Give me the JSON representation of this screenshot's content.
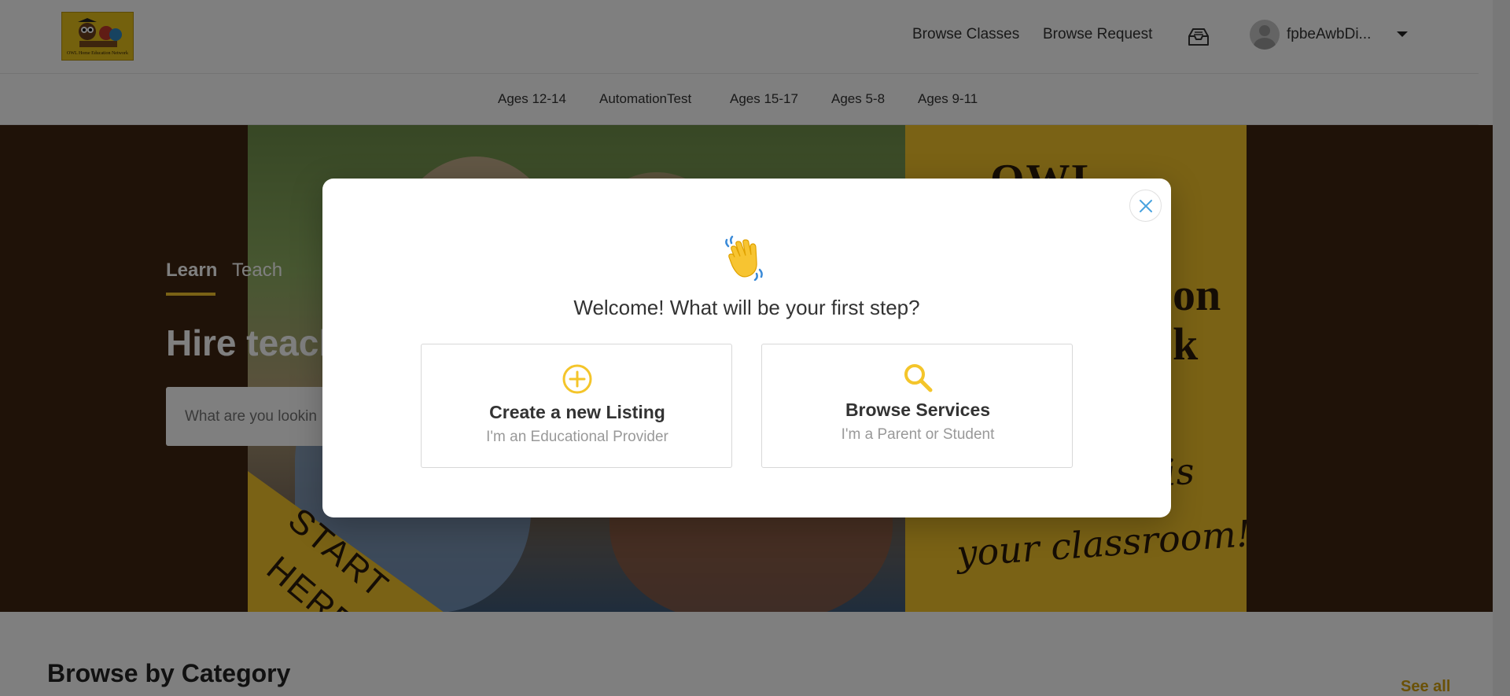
{
  "header": {
    "logo_text": "OWL Home Education Network",
    "nav": [
      "Browse Classes",
      "Browse Request"
    ],
    "inbox_icon": "inbox-icon",
    "username": "fpbeAwbDi..."
  },
  "categories": [
    "Ages 12-14",
    "AutomationTest",
    "Ages 15-17",
    "Ages 5-8",
    "Ages 9-11"
  ],
  "hero": {
    "tabs": [
      "Learn",
      "Teach"
    ],
    "heading": "Hire teach",
    "search_placeholder": "What are you lookin",
    "poster": {
      "title": "OWL",
      "word_1": "on",
      "word_2": "k",
      "script_1": "l is",
      "script_2": "your classroom!"
    },
    "banner_text_1": "START",
    "banner_text_2": "HERE"
  },
  "section": {
    "title": "Browse by Category",
    "see_all": "See all"
  },
  "modal": {
    "heading": "Welcome! What will be your first step?",
    "close_icon": "close-icon",
    "wave_icon": "waving-hand-icon",
    "options": [
      {
        "icon": "plus-circle-icon",
        "title": "Create a new Listing",
        "subtitle": "I'm an Educational Provider"
      },
      {
        "icon": "search-icon",
        "title": "Browse Services",
        "subtitle": "I'm a Parent or Student"
      }
    ]
  },
  "colors": {
    "accent": "#f4c52a",
    "see_all": "#d4a20f",
    "close": "#4aa3df"
  }
}
